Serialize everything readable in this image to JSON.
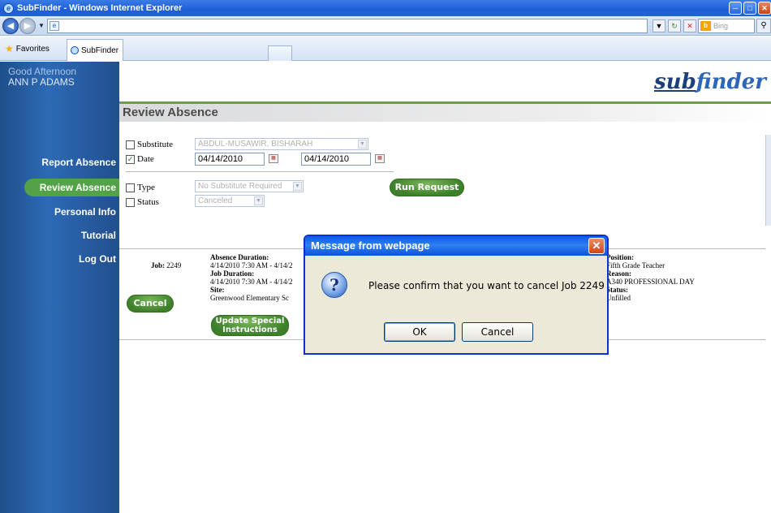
{
  "window": {
    "title": "SubFinder - Windows Internet Explorer"
  },
  "browser": {
    "search_placeholder": "Bing",
    "favorites_label": "Favorites",
    "tab_label": "SubFinder"
  },
  "sidebar": {
    "greeting": "Good Afternoon",
    "user_name": "ANN P ADAMS",
    "items": [
      {
        "label": "Report Absence"
      },
      {
        "label": "Review Absence"
      },
      {
        "label": "Personal Info"
      },
      {
        "label": "Tutorial"
      },
      {
        "label": "Log Out"
      }
    ]
  },
  "header": {
    "logo_sub": "sub",
    "logo_finder": "finder",
    "page_title": "Review Absence"
  },
  "filters": {
    "substitute_label": "Substitute",
    "substitute_value": "ABDUL-MUSAWIR, BISHARAH",
    "date_label": "Date",
    "date_from": "04/14/2010",
    "date_to": "04/14/2010",
    "type_label": "Type",
    "type_value": "No Substitute Required",
    "status_label": "Status",
    "status_value": "Canceled",
    "run_label": "Run Request"
  },
  "job": {
    "job_label": "Job:",
    "job_number": "2249",
    "absence_duration_label": "Absence Duration:",
    "absence_duration_value": "4/14/2010 7:30 AM - 4/14/2",
    "job_duration_label": "Job Duration:",
    "job_duration_value": "4/14/2010 7:30 AM - 4/14/2",
    "site_label": "Site:",
    "site_value": "Greenwood Elementary Sc",
    "cancel_label": "Cancel",
    "update_label_1": "Update Special",
    "update_label_2": "Instructions",
    "position_label": "Position:",
    "position_value": "Fifth Grade Teacher",
    "reason_label": "Reason:",
    "reason_value": "A340 PROFESSIONAL DAY",
    "status_label": "Status:",
    "status_value": "Unfilled"
  },
  "dialog": {
    "title": "Message from webpage",
    "message": "Please confirm that you want to cancel Job 2249",
    "ok_label": "OK",
    "cancel_label": "Cancel"
  }
}
